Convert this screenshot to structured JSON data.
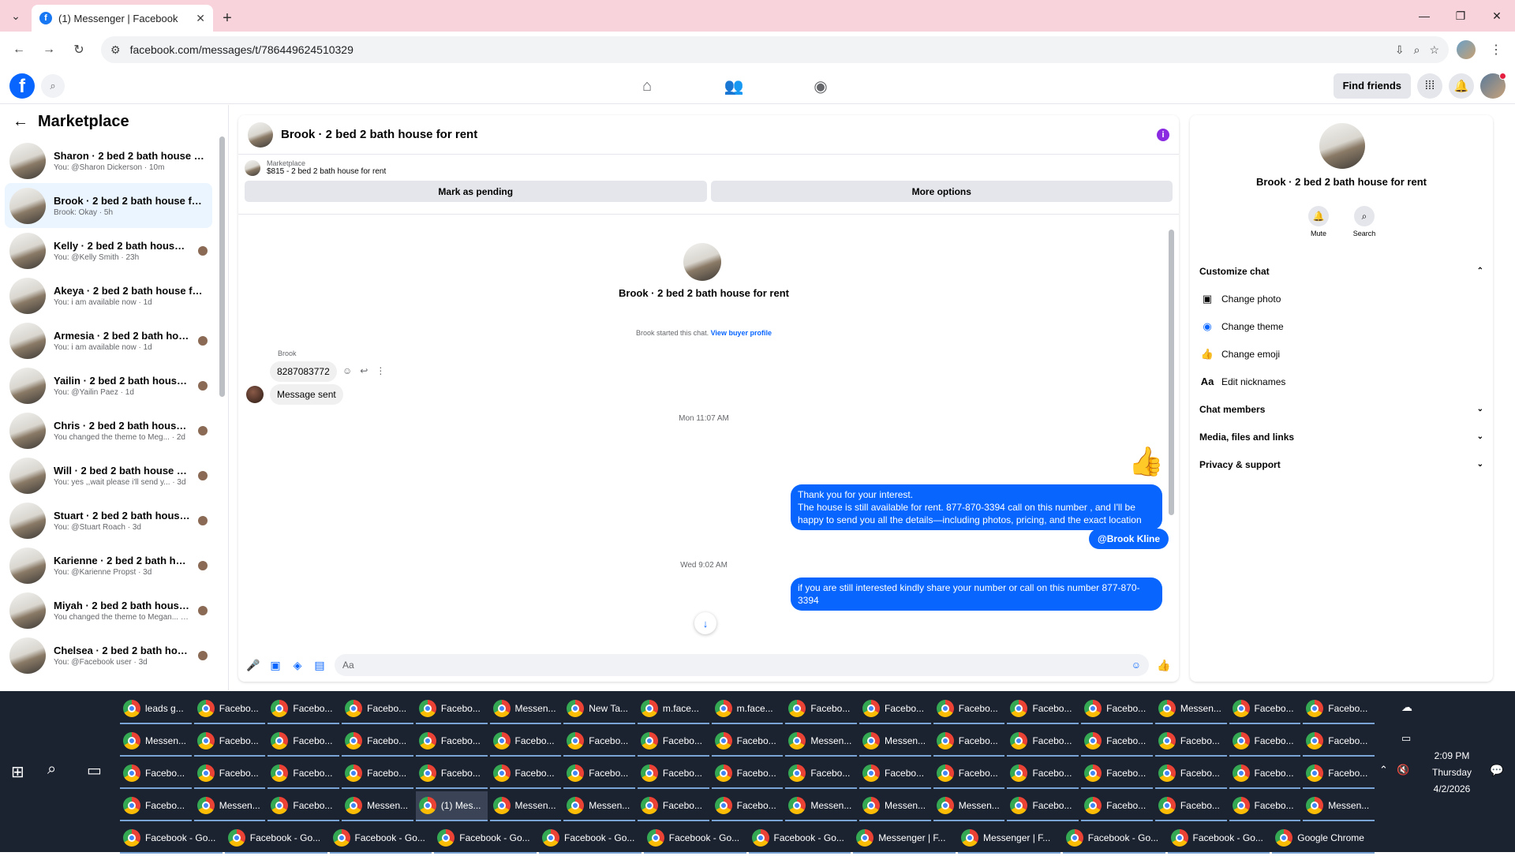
{
  "browser": {
    "tab_title": "(1) Messenger | Facebook",
    "url": "facebook.com/messages/t/786449624510329"
  },
  "fbnav": {
    "find_friends": "Find friends"
  },
  "leftpanel": {
    "title": "Marketplace",
    "conversations": [
      {
        "name": "Sharon · 2 bed 2 bath house for...",
        "preview": "You: @Sharon Dickerson · 10m"
      },
      {
        "name": "Brook · 2 bed 2 bath house for r...",
        "preview": "Brook: Okay · 5h"
      },
      {
        "name": "Kelly · 2 bed 2 bath house for...",
        "preview": "You: @Kelly Smith · 23h"
      },
      {
        "name": "Akeya · 2 bed 2 bath house for ...",
        "preview": "You: i am available now · 1d"
      },
      {
        "name": "Armesia · 2 bed 2 bath house...",
        "preview": "You: i am available now · 1d"
      },
      {
        "name": "Yailin · 2 bed 2 bath house fo...",
        "preview": "You: @Yailin Paez · 1d"
      },
      {
        "name": "Chris · 2 bed 2 bath house for...",
        "preview": "You changed the theme to Meg... · 2d"
      },
      {
        "name": "Will · 2 bed 2 bath house for ...",
        "preview": "You: yes ,,wait please i'll send y... · 3d"
      },
      {
        "name": "Stuart · 2 bed 2 bath house f...",
        "preview": "You: @Stuart Roach · 3d"
      },
      {
        "name": "Karienne · 2 bed 2 bath hous...",
        "preview": "You: @Karienne Propst · 3d"
      },
      {
        "name": "Miyah · 2 bed 2 bath house for ...",
        "preview": "You changed the theme to Megan... · 3d"
      },
      {
        "name": "Chelsea · 2 bed 2 bath house fo...",
        "preview": "You: @Facebook user · 3d"
      }
    ]
  },
  "chat": {
    "title": "Brook · 2 bed 2 bath house for rent",
    "marketplace_label": "Marketplace",
    "listing": "$815 - 2 bed 2 bath house for rent",
    "mark_pending": "Mark as pending",
    "more_options": "More options",
    "center_name": "Brook · 2 bed 2 bath house for rent",
    "started_text": "Brook started this chat.",
    "view_profile": "View buyer profile",
    "sender": "Brook",
    "msg_in_1": "8287083772",
    "msg_in_2": "Message sent",
    "time_1": "Mon 11:07 AM",
    "msg_out_1_line1": "Thank you for your interest.",
    "msg_out_1_line2": "The house is still available for rent. 877-870-3394 call on this number , and I'll be happy to send you all the details—including photos, pricing, and the exact location",
    "mention": "@Brook Kline",
    "time_2": "Wed 9:02 AM",
    "msg_out_2": "if you are still interested kindly share your number or call on this number 877-870-3394",
    "composer_placeholder": "Aa"
  },
  "rightpanel": {
    "name": "Brook · 2 bed 2 bath house for rent",
    "mute": "Mute",
    "search": "Search",
    "customize": "Customize chat",
    "change_photo": "Change photo",
    "change_theme": "Change theme",
    "change_emoji": "Change emoji",
    "edit_nicknames": "Edit nicknames",
    "chat_members": "Chat members",
    "media": "Media, files and links",
    "privacy": "Privacy & support"
  },
  "taskbar": {
    "rows": [
      [
        "leads g...",
        "Facebo...",
        "Facebo...",
        "Facebo...",
        "Facebo...",
        "Messen...",
        "New Ta...",
        "m.face...",
        "m.face...",
        "Facebo...",
        "Facebo...",
        "Facebo...",
        "Facebo...",
        "Facebo...",
        "Messen...",
        "Facebo...",
        "Facebo..."
      ],
      [
        "Messen...",
        "Facebo...",
        "Facebo...",
        "Facebo...",
        "Facebo...",
        "Facebo...",
        "Facebo...",
        "Facebo...",
        "Facebo...",
        "Messen...",
        "Messen...",
        "Facebo...",
        "Facebo...",
        "Facebo...",
        "Facebo...",
        "Facebo...",
        "Facebo..."
      ],
      [
        "Facebo...",
        "Facebo...",
        "Facebo...",
        "Facebo...",
        "Facebo...",
        "Facebo...",
        "Facebo...",
        "Facebo...",
        "Facebo...",
        "Facebo...",
        "Facebo...",
        "Facebo...",
        "Facebo...",
        "Facebo...",
        "Facebo...",
        "Facebo...",
        "Facebo..."
      ],
      [
        "Facebo...",
        "Messen...",
        "Facebo...",
        "Messen...",
        "(1) Mes...",
        "Messen...",
        "Messen...",
        "Facebo...",
        "Facebo...",
        "Messen...",
        "Messen...",
        "Messen...",
        "Facebo...",
        "Facebo...",
        "Facebo...",
        "Facebo...",
        "Messen..."
      ]
    ],
    "bottom_row": [
      "Facebook - Go...",
      "Facebook - Go...",
      "Facebook - Go...",
      "Facebook - Go...",
      "Facebook - Go...",
      "Facebook - Go...",
      "Facebook - Go...",
      "Messenger | F...",
      "Messenger | F...",
      "Facebook - Go...",
      "Facebook - Go...",
      "Google Chrome"
    ],
    "time": "2:09 PM",
    "day": "Thursday",
    "date": "4/2/2026"
  }
}
